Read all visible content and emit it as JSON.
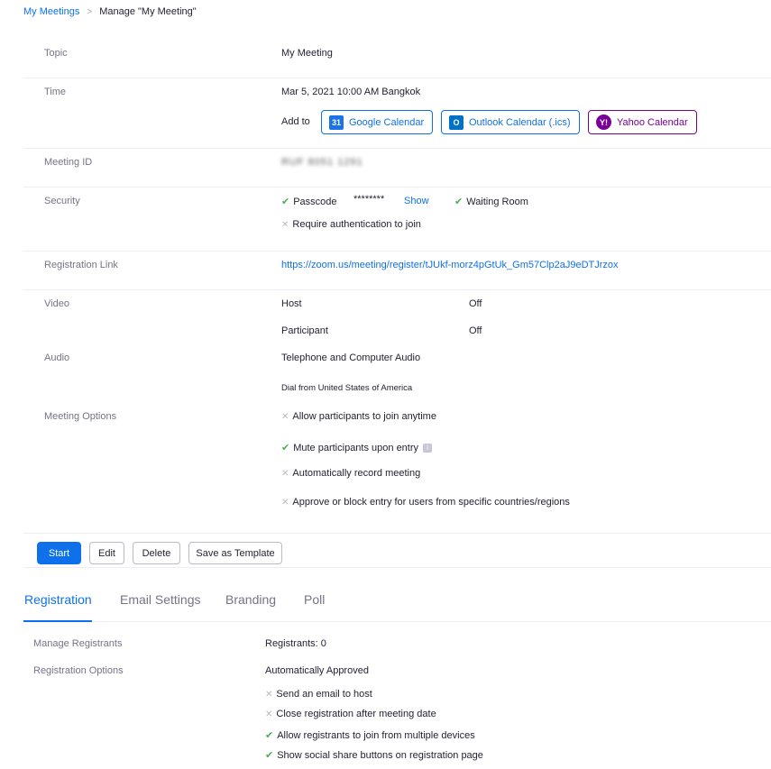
{
  "breadcrumb": {
    "root": "My Meetings",
    "separator": ">",
    "current": "Manage \"My Meeting\""
  },
  "topic": {
    "label": "Topic",
    "value": "My Meeting"
  },
  "time": {
    "label": "Time",
    "value": "Mar 5, 2021 10:00 AM Bangkok",
    "add_to": "Add to",
    "google": "Google Calendar",
    "outlook": "Outlook Calendar (.ics)",
    "yahoo": "Yahoo Calendar"
  },
  "meeting_id": {
    "label": "Meeting ID",
    "value": "RUF 8051 1291"
  },
  "security": {
    "label": "Security",
    "passcode": "Passcode",
    "passcode_mask": "********",
    "show": "Show",
    "waiting_room": "Waiting Room",
    "require_auth": "Require authentication to join"
  },
  "registration_link": {
    "label": "Registration Link",
    "url": "https://zoom.us/meeting/register/tJUkf-morz4pGtUk_Gm57Clp2aJ9eDTJrzox"
  },
  "video": {
    "label": "Video",
    "host": "Host",
    "host_value": "Off",
    "participant": "Participant",
    "participant_value": "Off"
  },
  "audio": {
    "label": "Audio",
    "value": "Telephone and Computer Audio",
    "dial": "Dial from United States of America"
  },
  "meeting_options": {
    "label": "Meeting Options",
    "join_anytime": "Allow participants to join anytime",
    "mute": "Mute participants upon entry",
    "auto_record": "Automatically record meeting",
    "approve_block": "Approve or block entry for users from specific countries/regions"
  },
  "actions": {
    "start": "Start",
    "edit": "Edit",
    "delete": "Delete",
    "save_template": "Save as Template"
  },
  "tabs": [
    "Registration",
    "Email Settings",
    "Branding",
    "Poll"
  ],
  "registration": {
    "manage_label": "Manage Registrants",
    "manage_value": "Registrants: 0",
    "options_label": "Registration Options",
    "approval": "Automatically Approved",
    "opt_email_host": "Send an email to host",
    "opt_close": "Close registration after meeting date",
    "opt_multi_device": "Allow registrants to join from multiple devices",
    "opt_social": "Show social share buttons on registration page"
  },
  "colors": {
    "accent": "#0e71eb",
    "yahoo": "#7b0099",
    "check": "#4caf50"
  },
  "icons": {
    "google": "google-calendar-icon",
    "outlook": "outlook-icon",
    "yahoo": "yahoo-icon",
    "check": "check-icon",
    "cross": "cross-icon",
    "info": "info-icon"
  }
}
